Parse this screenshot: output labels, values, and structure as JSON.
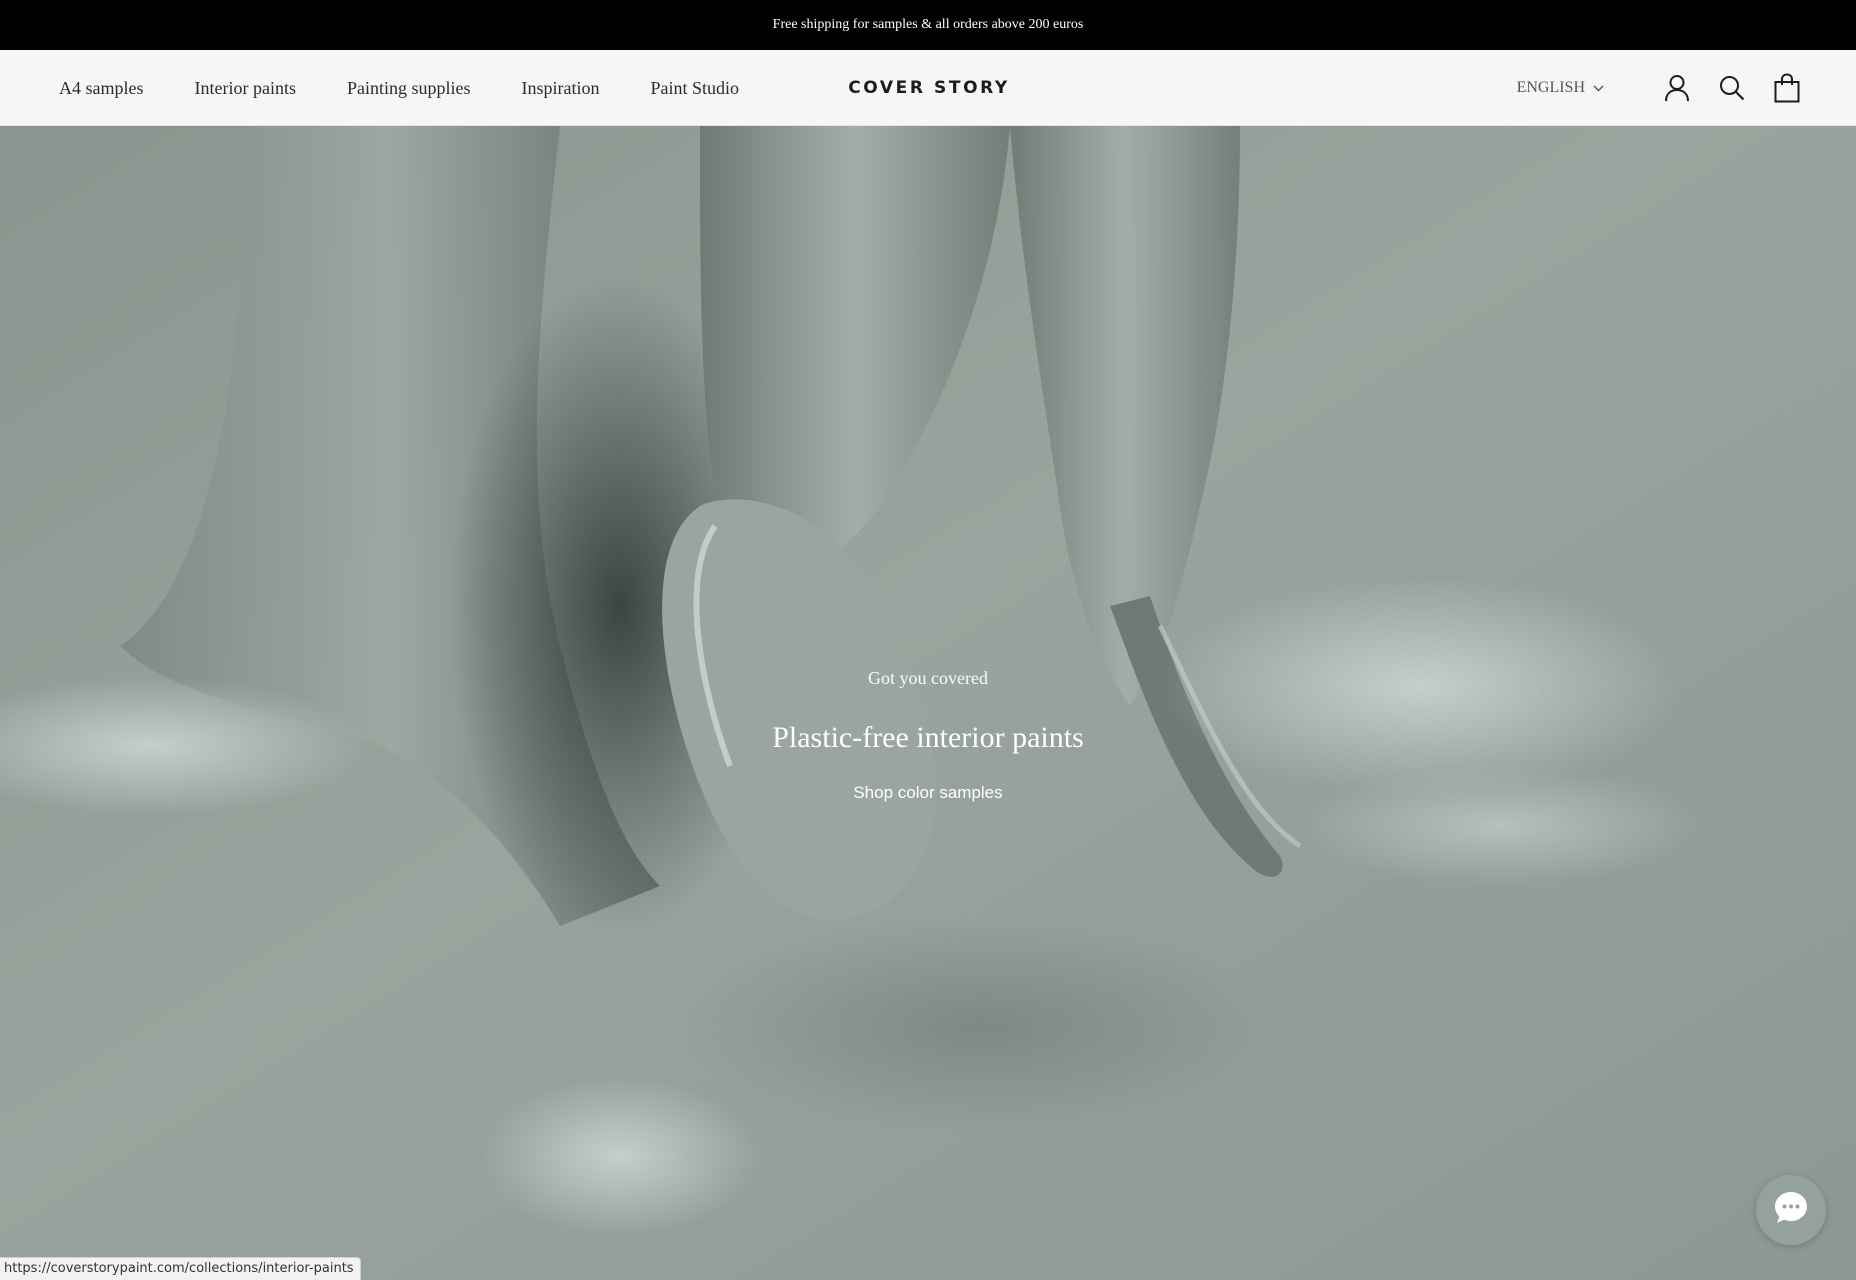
{
  "announcement": {
    "text": "Free shipping for samples & all orders above 200 euros"
  },
  "header": {
    "nav_items": [
      {
        "label": "A4 samples"
      },
      {
        "label": "Interior paints"
      },
      {
        "label": "Painting supplies"
      },
      {
        "label": "Inspiration"
      },
      {
        "label": "Paint Studio"
      }
    ],
    "logo": "COVER STORY",
    "language": "ENGLISH",
    "icons": {
      "language_toggle": "chevron-down-icon",
      "account": "user-icon",
      "search": "search-icon",
      "cart": "shopping-bag-icon"
    }
  },
  "hero": {
    "kicker": "Got you covered",
    "title": "Plastic-free interior paints",
    "cta": "Shop color samples"
  },
  "status_bar": {
    "url": "https://coverstorypaint.com/collections/interior-paints"
  },
  "chat": {
    "icon": "chat-bubble-icon"
  },
  "colors": {
    "announcement_bg": "#000000",
    "header_bg": "#f6f6f5",
    "hero_tint": "#8f9b94",
    "text_dark": "#2b2b2b"
  }
}
